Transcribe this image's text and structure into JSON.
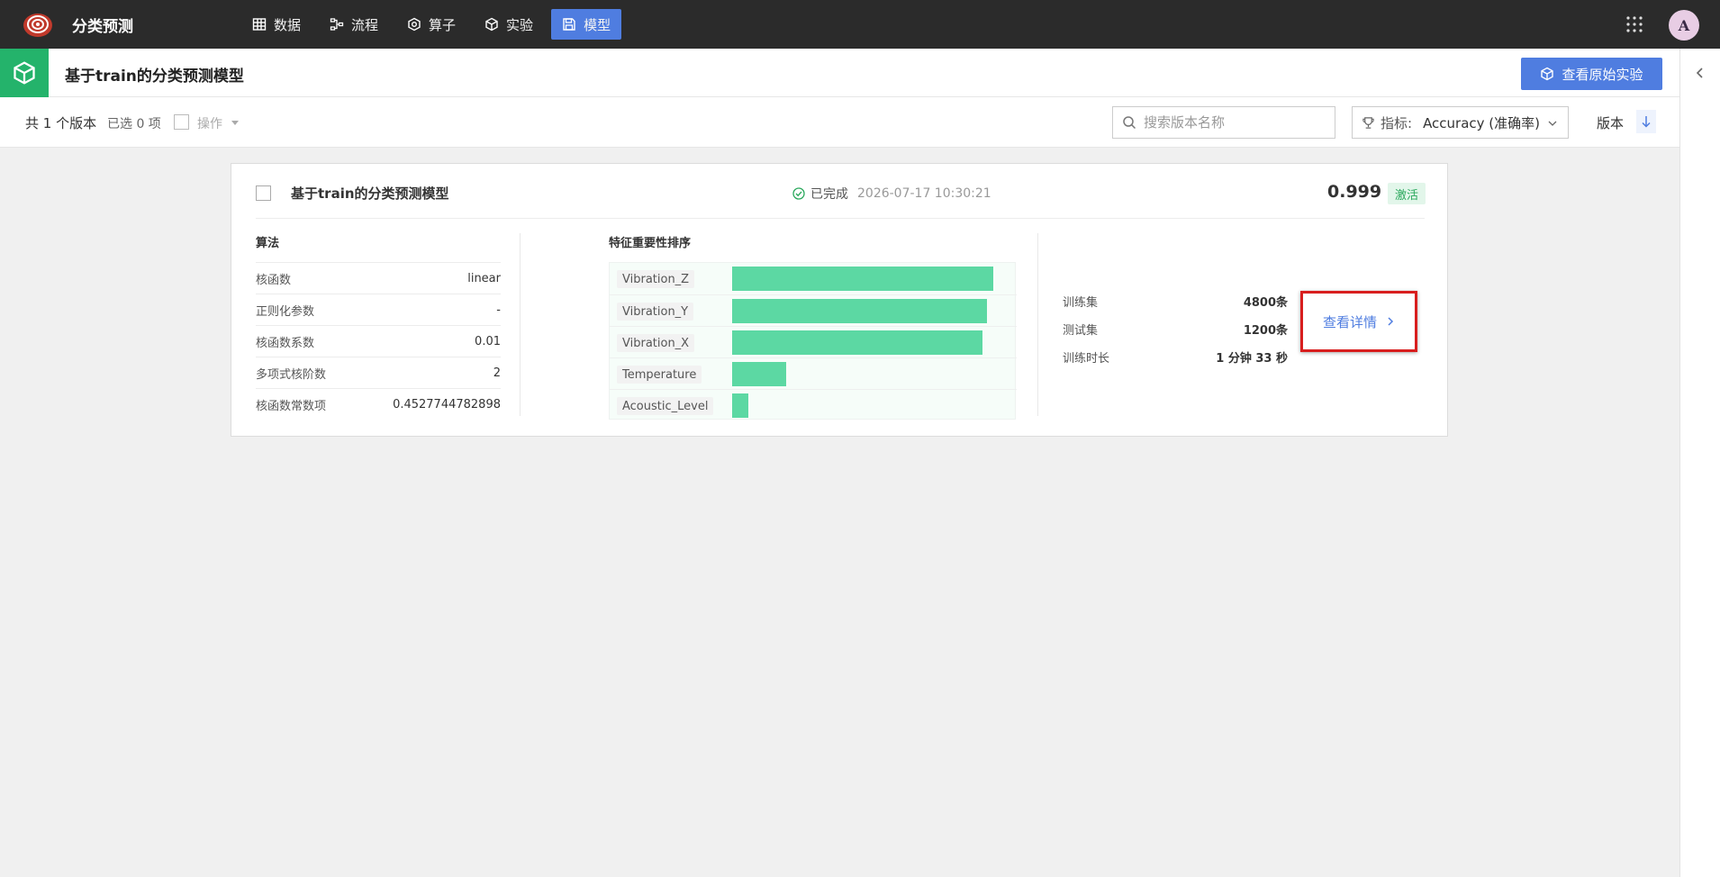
{
  "app": {
    "title": "分类预测",
    "avatar_letter": "A",
    "accent_color": "#4f7de0",
    "nav": [
      {
        "label": "数据",
        "icon": "table-icon",
        "active": false
      },
      {
        "label": "流程",
        "icon": "flow-icon",
        "active": false
      },
      {
        "label": "算子",
        "icon": "operator-icon",
        "active": false
      },
      {
        "label": "实验",
        "icon": "cube-icon",
        "active": false
      },
      {
        "label": "模型",
        "icon": "save-icon",
        "active": true
      }
    ]
  },
  "header": {
    "title": "基于train的分类预测模型",
    "view_experiment_label": "查看原始实验"
  },
  "toolbar": {
    "count_text": "共 1 个版本",
    "selected_text": "已选 0 项",
    "operation_label": "操作",
    "search_placeholder": "搜索版本名称",
    "metric_label": "指标:",
    "metric_value": "Accuracy (准确率)",
    "version_label": "版本"
  },
  "card": {
    "title": "基于train的分类预测模型",
    "status": "已完成",
    "timestamp": "2026-07-17 10:30:21",
    "score": "0.999",
    "badge": "激活",
    "algorithm": {
      "title": "算法",
      "rows": [
        {
          "key": "核函数",
          "value": "linear"
        },
        {
          "key": "正则化参数",
          "value": "-"
        },
        {
          "key": "核函数系数",
          "value": "0.01"
        },
        {
          "key": "多项式核阶数",
          "value": "2"
        },
        {
          "key": "核函数常数项",
          "value": "0.4527744782898"
        }
      ]
    },
    "features": {
      "title": "特征重要性排序",
      "items": [
        {
          "name": "Vibration_Z",
          "importance": 1.0
        },
        {
          "name": "Vibration_Y",
          "importance": 0.975
        },
        {
          "name": "Vibration_X",
          "importance": 0.958
        },
        {
          "name": "Temperature",
          "importance": 0.206
        },
        {
          "name": "Acoustic_Level",
          "importance": 0.063
        }
      ]
    },
    "training": [
      {
        "key": "训练集",
        "value": "4800条"
      },
      {
        "key": "测试集",
        "value": "1200条"
      },
      {
        "key": "训练时长",
        "value": "1 分钟 33 秒"
      }
    ],
    "detail_label": "查看详情"
  }
}
